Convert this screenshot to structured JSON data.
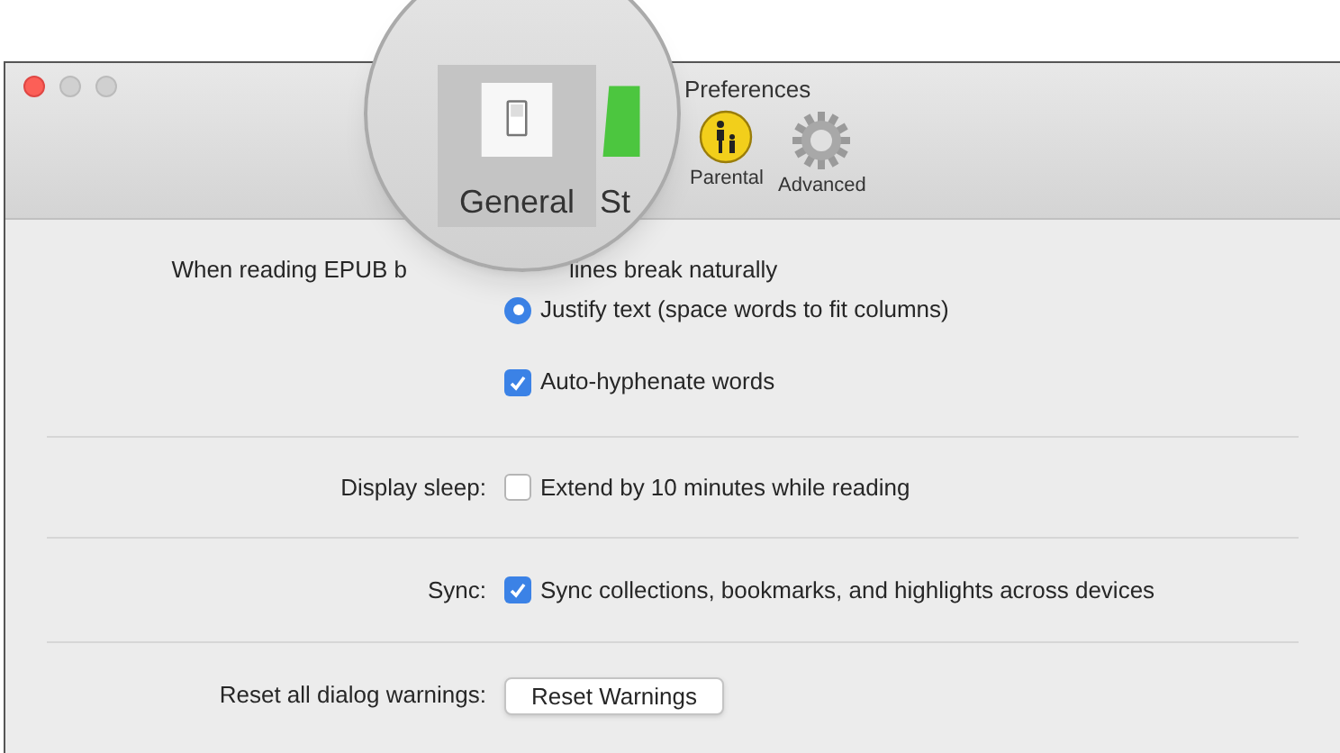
{
  "window": {
    "title": "Preferences"
  },
  "toolbar": [
    {
      "label": "Parental",
      "kind": "parental",
      "selected": false
    },
    {
      "label": "Advanced",
      "kind": "advanced",
      "selected": false
    }
  ],
  "magnifier": {
    "items": [
      {
        "label": "General",
        "kind": "general",
        "selected": true
      },
      {
        "label": "St",
        "kind": "store",
        "selected": false
      }
    ]
  },
  "epub": {
    "label": "When reading EPUB b",
    "options": [
      {
        "label": "lines break naturally",
        "kind": "hidden"
      },
      {
        "label": "Justify text (space words to fit columns)",
        "kind": "radio",
        "selected": true
      }
    ],
    "hyphenate": {
      "label": "Auto-hyphenate words",
      "checked": true
    }
  },
  "display_sleep": {
    "label": "Display sleep:",
    "option": {
      "label": "Extend by 10 minutes while reading",
      "checked": false
    }
  },
  "sync": {
    "label": "Sync:",
    "option": {
      "label": "Sync collections, bookmarks, and highlights across devices",
      "checked": true
    }
  },
  "reset": {
    "label": "Reset all dialog warnings:",
    "button": "Reset Warnings"
  }
}
